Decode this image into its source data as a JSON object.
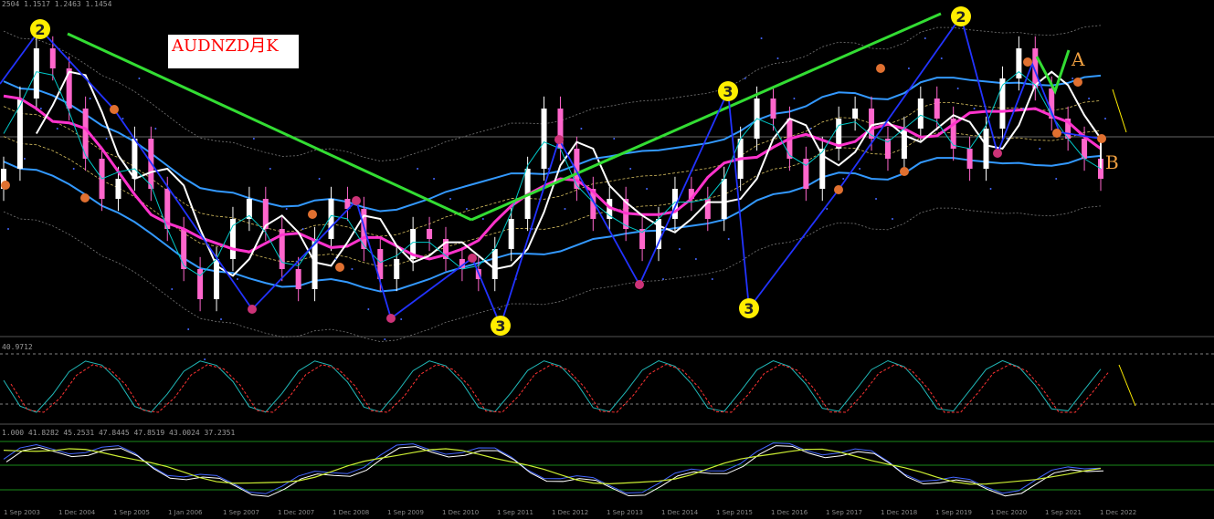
{
  "chart_data": {
    "type": "line",
    "title": "AUDNZD月K",
    "header_ohlc": "2504 1.1517 1.2463 1.1454",
    "indicator1_label": "40.9712",
    "indicator2_label": "1.000 41.8282 45.2531 47.8445 47.8519 43.0024 37.2351",
    "annotations": [
      "A",
      "B"
    ],
    "wave_labels": [
      "2",
      "3",
      "3",
      "2"
    ],
    "date_ticks": [
      "1 Sep 2003",
      "1 Dec 2004",
      "1 Sep 2005",
      "1 Jan 2006",
      "1 Sep 2007",
      "1 Dec 2007",
      "1 Dec 2008",
      "1 Sep 2009",
      "1 Dec 2010",
      "1 Sep 2011",
      "1 Dec 2012",
      "1 Sep 2013",
      "1 Dec 2014",
      "1 Sep 2015",
      "1 Dec 2016",
      "1 Sep 2017",
      "1 Dec 2018",
      "1 Sep 2019",
      "1 Dec 2020",
      "1 Sep 2021",
      "1 Dec 2022"
    ],
    "price_close": [
      1.15,
      1.22,
      1.27,
      1.25,
      1.21,
      1.16,
      1.12,
      1.14,
      1.18,
      1.13,
      1.09,
      1.05,
      1.02,
      1.06,
      1.1,
      1.12,
      1.09,
      1.05,
      1.03,
      1.08,
      1.12,
      1.11,
      1.07,
      1.04,
      1.06,
      1.09,
      1.08,
      1.06,
      1.05,
      1.04,
      1.07,
      1.1,
      1.15,
      1.21,
      1.17,
      1.13,
      1.1,
      1.12,
      1.09,
      1.07,
      1.1,
      1.13,
      1.12,
      1.1,
      1.14,
      1.18,
      1.22,
      1.2,
      1.16,
      1.13,
      1.17,
      1.2,
      1.21,
      1.18,
      1.16,
      1.19,
      1.22,
      1.2,
      1.17,
      1.15,
      1.19,
      1.24,
      1.27,
      1.23,
      1.2,
      1.18,
      1.16,
      1.14
    ],
    "colors": {
      "background": "#000000",
      "candle_up": "#ffffff",
      "candle_down": "#ff66cc",
      "ma_magenta": "#ff33cc",
      "ma_white": "#ffffff",
      "band_blue": "#3399ff",
      "trend_green": "#33dd33",
      "wave_blue": "#2233ff",
      "marker_yellow": "#ffee00"
    }
  }
}
